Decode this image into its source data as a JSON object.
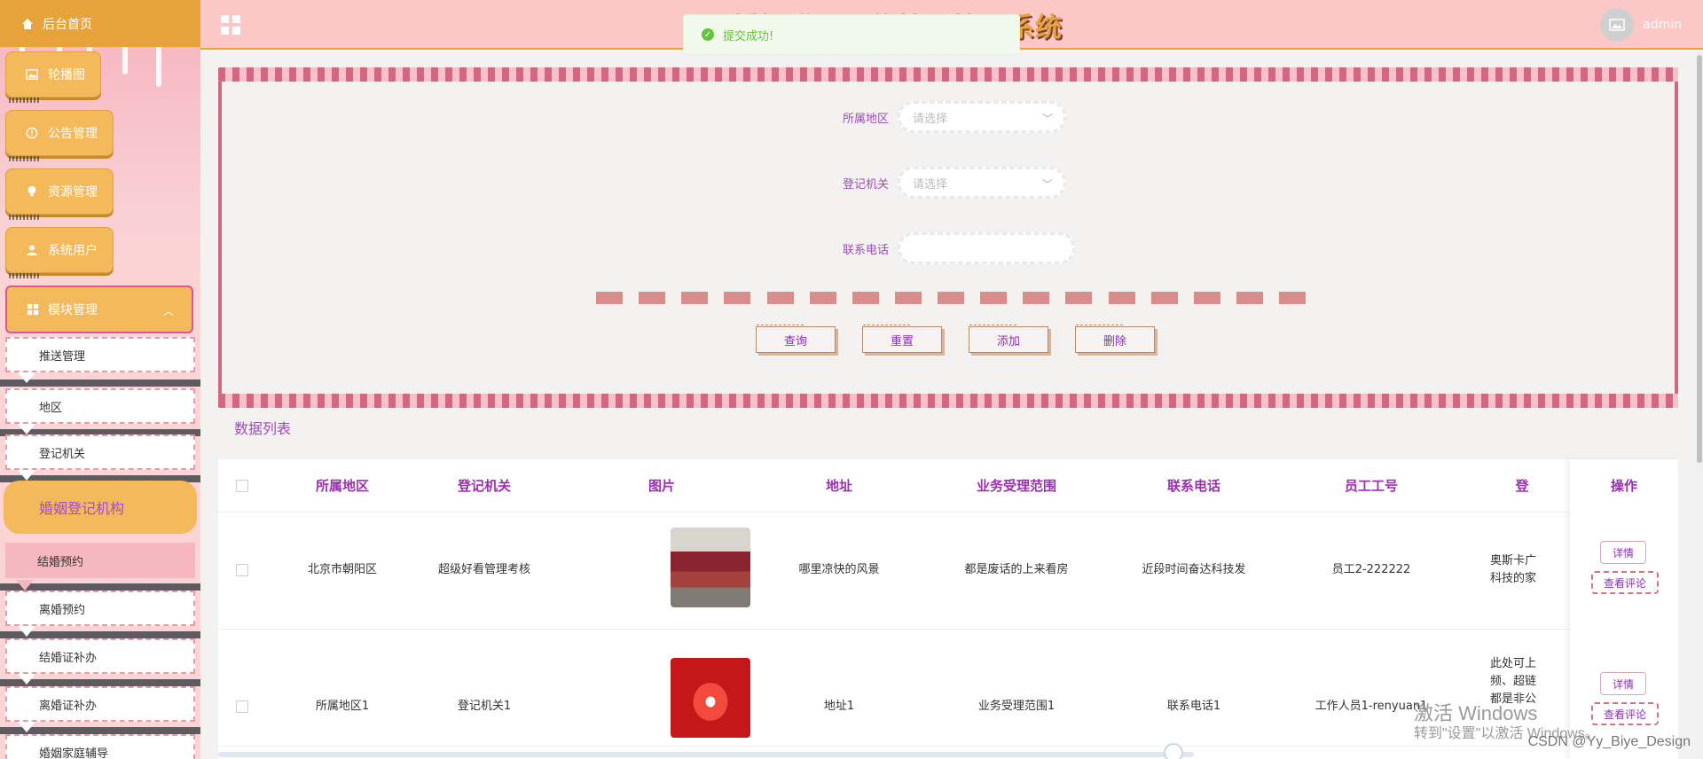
{
  "header": {
    "title": "婚姻登记预约挂号管理系统",
    "username": "admin"
  },
  "toast": {
    "message": "提交成功!"
  },
  "sidebar": {
    "home": "后台首页",
    "menus": [
      {
        "label": "轮播图",
        "icon": "image-icon"
      },
      {
        "label": "公告管理",
        "icon": "info-icon"
      },
      {
        "label": "资源管理",
        "icon": "bulb-icon"
      },
      {
        "label": "系统用户",
        "icon": "user-icon"
      }
    ],
    "open_menu": {
      "label": "模块管理",
      "icon": "grid-icon"
    },
    "subitems": [
      "推送管理",
      "地区",
      "登记机关"
    ],
    "active_group": "婚姻登记机构",
    "subitems2": [
      "结婚预约",
      "离婚预约",
      "结婚证补办",
      "离婚证补办",
      "婚姻家庭辅导"
    ]
  },
  "search": {
    "region_label": "所属地区",
    "region_placeholder": "请选择",
    "authority_label": "登记机关",
    "authority_placeholder": "请选择",
    "phone_label": "联系电话",
    "buttons": {
      "query": "查询",
      "reset": "重置",
      "add": "添加",
      "delete": "删除"
    }
  },
  "list_title": "数据列表",
  "table": {
    "columns": [
      "所属地区",
      "登记机关",
      "图片",
      "地址",
      "业务受理范围",
      "联系电话",
      "员工工号",
      "登",
      "操作"
    ],
    "rows": [
      {
        "region": "北京市朝阳区",
        "authority": "超级好看管理考核",
        "address": "哪里凉快的风景",
        "scope": "都是废话的上来看房",
        "phone": "近段时间奋达科技发",
        "staff_id": "员工2-222222",
        "extra_line1": "奥斯卡广",
        "extra_line2": "科技的家"
      },
      {
        "region": "所属地区1",
        "authority": "登记机关1",
        "address": "地址1",
        "scope": "业务受理范围1",
        "phone": "联系电话1",
        "staff_id": "工作人员1-renyuan1",
        "extra_line1": "此处可上",
        "extra_line2": "频、超链",
        "extra_line3": "都是非公"
      }
    ],
    "op_detail": "详情",
    "op_comment": "查看评论"
  },
  "watermark": {
    "line1": "激活 Windows",
    "line2": "转到\"设置\"以激活 Windows。"
  },
  "csdn": "CSDN @Yy_Biye_Design"
}
